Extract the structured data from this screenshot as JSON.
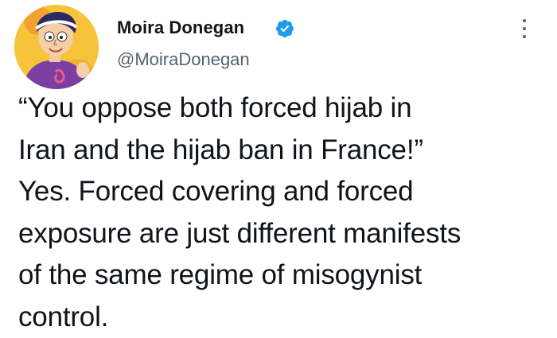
{
  "author": {
    "name": "Moira Donegan",
    "handle": "@MoiraDonegan",
    "verified": true,
    "avatar_icon": "cartoon-character-avatar"
  },
  "tweet": {
    "text": "“You oppose both forced hijab in\nIran and the hijab ban in France!”\nYes. Forced covering and forced\nexposure are just different manifests\nof the same regime of misogynist\ncontrol."
  },
  "colors": {
    "text": "#0f1419",
    "secondary": "#536471",
    "verified_badge": "#1d9bf0",
    "background": "#ffffff"
  },
  "icons": {
    "verified": "verified-badge-icon",
    "more": "more-options-icon"
  }
}
